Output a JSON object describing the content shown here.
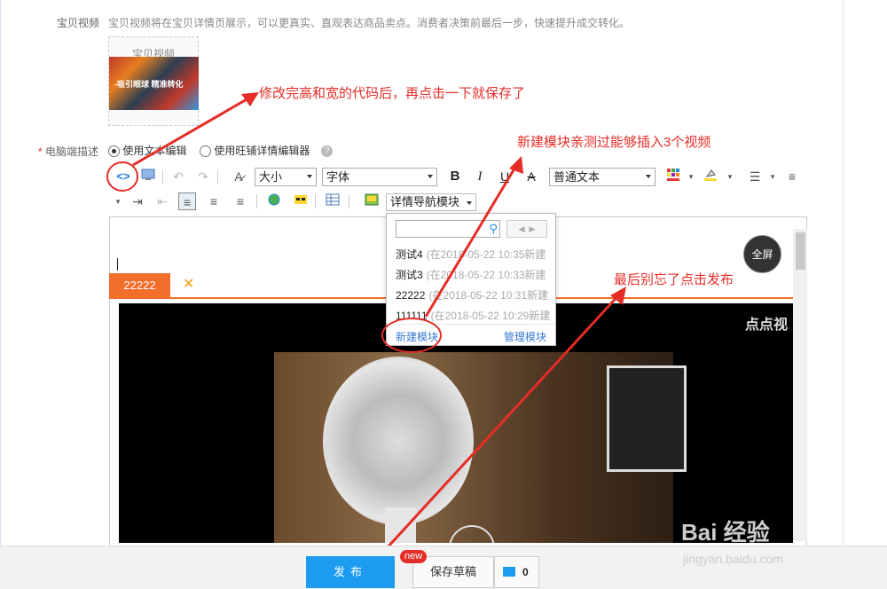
{
  "form": {
    "video_label": "宝贝视频",
    "video_desc": "宝贝视频将在宝贝详情页展示，可以更真实、直观表达商品卖点。消费者决策前最后一步，快速提升成交转化。",
    "thumb_title": "宝贝视频",
    "thumb_caption": "-吸引眼球 精准转化",
    "desc_label": "电脑端描述",
    "desc_required": "*",
    "radio_text_editor": "使用文本编辑",
    "radio_wangpu": "使用旺铺详情编辑器",
    "help": "?"
  },
  "toolbar": {
    "size_select": "大小",
    "font_select": "字体",
    "bold": "B",
    "italic": "I",
    "format_select": "普通文本",
    "module_select": "详情导航模块"
  },
  "dropdown": {
    "items": [
      {
        "name": "测试4",
        "time": "(在2018-05-22 10:35新建"
      },
      {
        "name": "测试3",
        "time": "(在2018-05-22 10:33新建"
      },
      {
        "name": "22222",
        "time": "(在2018-05-22 10:31新建"
      },
      {
        "name": "111111",
        "time": "(在2018-05-22 10:29新建"
      }
    ],
    "new_module": "新建模块",
    "manage_module": "管理模块"
  },
  "editor": {
    "tab_label": "22222",
    "tab_close": "✕",
    "fullscreen": "全屏",
    "video_watermark": "点点视"
  },
  "annotations": {
    "a1": "修改完高和宽的代码后，再点击一下就保存了",
    "a2": "新建模块亲测过能够插入3个视频",
    "a3": "最后别忘了点击发布"
  },
  "bottom": {
    "publish": "发布",
    "draft": "保存草稿",
    "new_badge": "new",
    "msg_count": "0"
  },
  "watermark": {
    "brand": "Bai 经验",
    "url": "jingyan.baidu.com"
  }
}
